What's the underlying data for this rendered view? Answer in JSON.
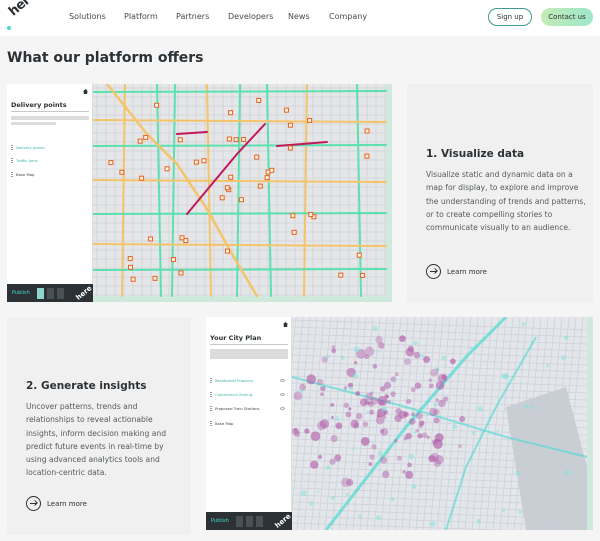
{
  "nav": {
    "logo_text": "here",
    "links": [
      "Solutions",
      "Platform",
      "Partners",
      "Developers",
      "News",
      "Company"
    ],
    "signup": "Sign up",
    "contact": "Contact us"
  },
  "section_title": "What our platform offers",
  "features": [
    {
      "heading": "1. Visualize data",
      "text": "Visualize static and dynamic data on a map for display, to explore and improve the understanding of trends and patterns, or to create compelling stories to communicate visually to an audience.",
      "link": "Learn more"
    },
    {
      "heading": "2. Generate insights",
      "text": "Uncover patterns, trends and relationships to reveal actionable insights, inform decision making and predict future events in real-time by using advanced analytics tools and location-centric data.",
      "link": "Learn more"
    }
  ],
  "mock1": {
    "panel_title": "Delivery points",
    "layers": [
      "Delivery points",
      "Traffic jams",
      "Base Map"
    ],
    "publish": "Publish",
    "logo_text": "here"
  },
  "mock2": {
    "panel_title": "Your City Plan",
    "layers": [
      "Residential Property",
      "Commercial Zoning",
      "Proposed Train Stations",
      "Base Map"
    ],
    "publish": "Publish",
    "logo_text": "here"
  },
  "colors": {
    "accent": "#48dad0",
    "road_green": "#5ce0b0",
    "road_yellow": "#f5c36a",
    "road_red": "#c0185a",
    "marker": "#e8621f",
    "heat": "#b05aa8"
  }
}
